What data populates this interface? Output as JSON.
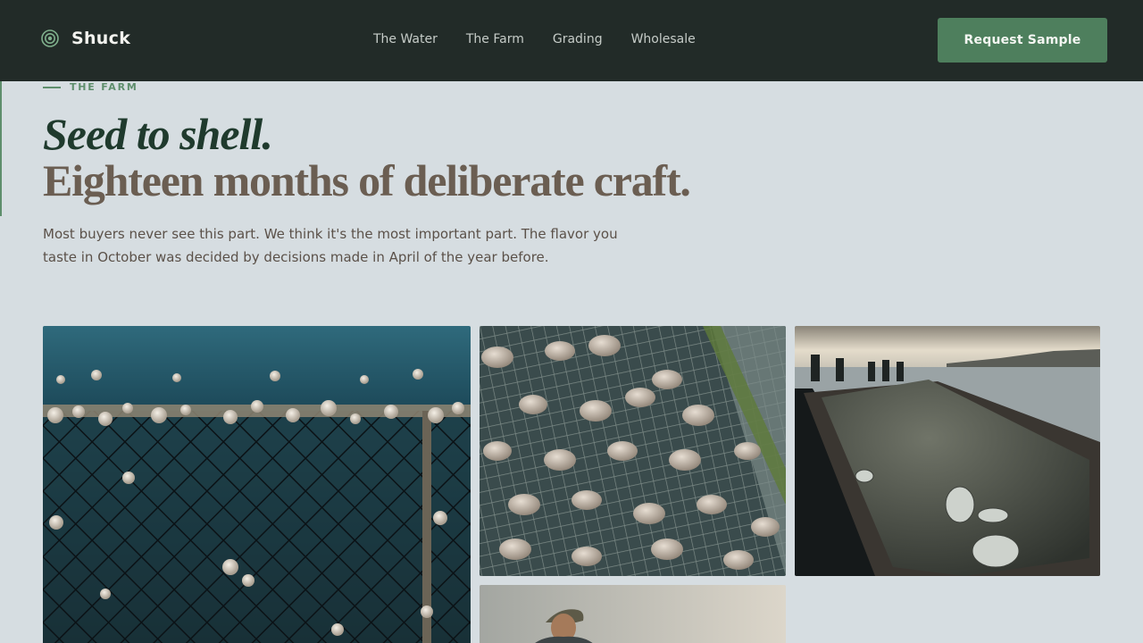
{
  "brand": {
    "name": "Shuck",
    "logo_icon": "target-ring-icon"
  },
  "nav": {
    "items": [
      "The Water",
      "The Farm",
      "Grading",
      "Wholesale"
    ]
  },
  "header": {
    "cta_label": "Request Sample"
  },
  "hero": {
    "eyebrow": "THE FARM",
    "headline_line1": "Seed to shell.",
    "headline_line2": "Eighteen months of deliberate craft.",
    "lede": "Most buyers never see this part. We think it's the most important part. The flavor you taste in October was decided by decisions made in April of the year before."
  },
  "gallery": {
    "photos": [
      {
        "subject": "barnacle-covered oyster cage underwater"
      },
      {
        "subject": "oyster seed on mesh tray in water"
      },
      {
        "subject": "harvested oysters piled on dock at sunset"
      },
      {
        "subject": "oyster farmer portrait"
      }
    ]
  },
  "colors": {
    "header_bg": "#222b28",
    "page_bg": "#d6dde1",
    "accent_green": "#4e7f5d",
    "headline_green": "#1f3a2d",
    "headline_brown": "#6b5e52"
  }
}
